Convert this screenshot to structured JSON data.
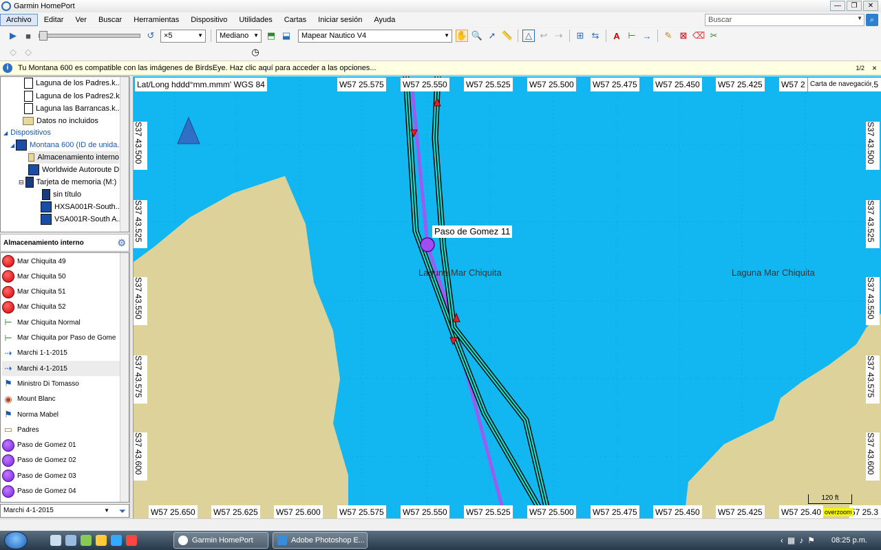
{
  "window": {
    "title": "Garmin HomePort"
  },
  "menu": [
    "Archivo",
    "Editar",
    "Ver",
    "Buscar",
    "Herramientas",
    "Dispositivo",
    "Utilidades",
    "Cartas",
    "Iniciar sesión",
    "Ayuda"
  ],
  "search": {
    "placeholder": "Buscar"
  },
  "toolbar": {
    "speed": "×5",
    "size": "Mediano",
    "map": "Mapear Nautico V4"
  },
  "info": {
    "message": "Tu Montana 600  es compatible con las imágenes de BirdsEye. Haz clic aquí para acceder a las opciones...",
    "page": "1/2"
  },
  "tree": {
    "items": [
      "Laguna de los Padres.k...",
      "Laguna de los Padres2.k...",
      "Laguna las Barrancas.k...",
      "Datos no incluidos",
      "Dispositivos",
      "Montana 600 (ID de unida...",
      "Almacenamiento interno",
      "Worldwide Autoroute D...",
      "Tarjeta de memoria (M:)",
      "sin título",
      "HXSA001R-South...",
      "VSA001R-South A..."
    ]
  },
  "panel": {
    "title": "Almacenamiento interno"
  },
  "list": [
    {
      "label": "Mar Chiquita 49",
      "type": "red"
    },
    {
      "label": "Mar Chiquita 50",
      "type": "red"
    },
    {
      "label": "Mar Chiquita 51",
      "type": "red"
    },
    {
      "label": "Mar Chiquita 52",
      "type": "red"
    },
    {
      "label": "Mar Chiquita Normal",
      "type": "route"
    },
    {
      "label": "Mar Chiquita por Paso de Gome",
      "type": "route"
    },
    {
      "label": "Marchi 1-1-2015",
      "type": "track"
    },
    {
      "label": "Marchi 4-1-2015",
      "type": "track"
    },
    {
      "label": "Ministro Di Tomasso",
      "type": "flag"
    },
    {
      "label": "Mount Blanc",
      "type": "mount"
    },
    {
      "label": "Norma Mabel",
      "type": "flag"
    },
    {
      "label": "Padres",
      "type": "chest"
    },
    {
      "label": "Paso de Gomez 01",
      "type": "purple"
    },
    {
      "label": "Paso de Gomez 02",
      "type": "purple"
    },
    {
      "label": "Paso de Gomez 03",
      "type": "purple"
    },
    {
      "label": "Paso de Gomez 04",
      "type": "purple"
    }
  ],
  "bottom_combo": "Marchi 4-1-2015",
  "map": {
    "format": "Lat/Long hddd°mm.mmm' WGS 84",
    "chart_label": "Carta de navegación",
    "top_lon": [
      "W57 25.575",
      "W57 25.550",
      "W57 25.525",
      "W57 25.500",
      "W57 25.475",
      "W57 25.450",
      "W57 25.425",
      "W57 2"
    ],
    "top_right_partial": ".5",
    "bottom_lon": [
      "W57 25.650",
      "W57 25.625",
      "W57 25.600",
      "W57 25.575",
      "W57 25.550",
      "W57 25.525",
      "W57 25.500",
      "W57 25.475",
      "W57 25.450",
      "W57 25.425",
      "W57 25.40"
    ],
    "bottom_right_partial": "57 25.3",
    "lat": [
      "S37 43.500",
      "S37 43.525",
      "S37 43.550",
      "S37 43.575",
      "S37 43.600"
    ],
    "waypoint": "Paso de Gomez 11",
    "lake1": "Laguna Mar Chiquita",
    "lake2": "Laguna Mar Chiquita",
    "scale": "120 ft",
    "overzoom": "overzoom"
  },
  "taskbar": {
    "tasks": [
      "Garmin HomePort",
      "Adobe Photoshop E..."
    ],
    "clock": "08:25 p.m."
  }
}
